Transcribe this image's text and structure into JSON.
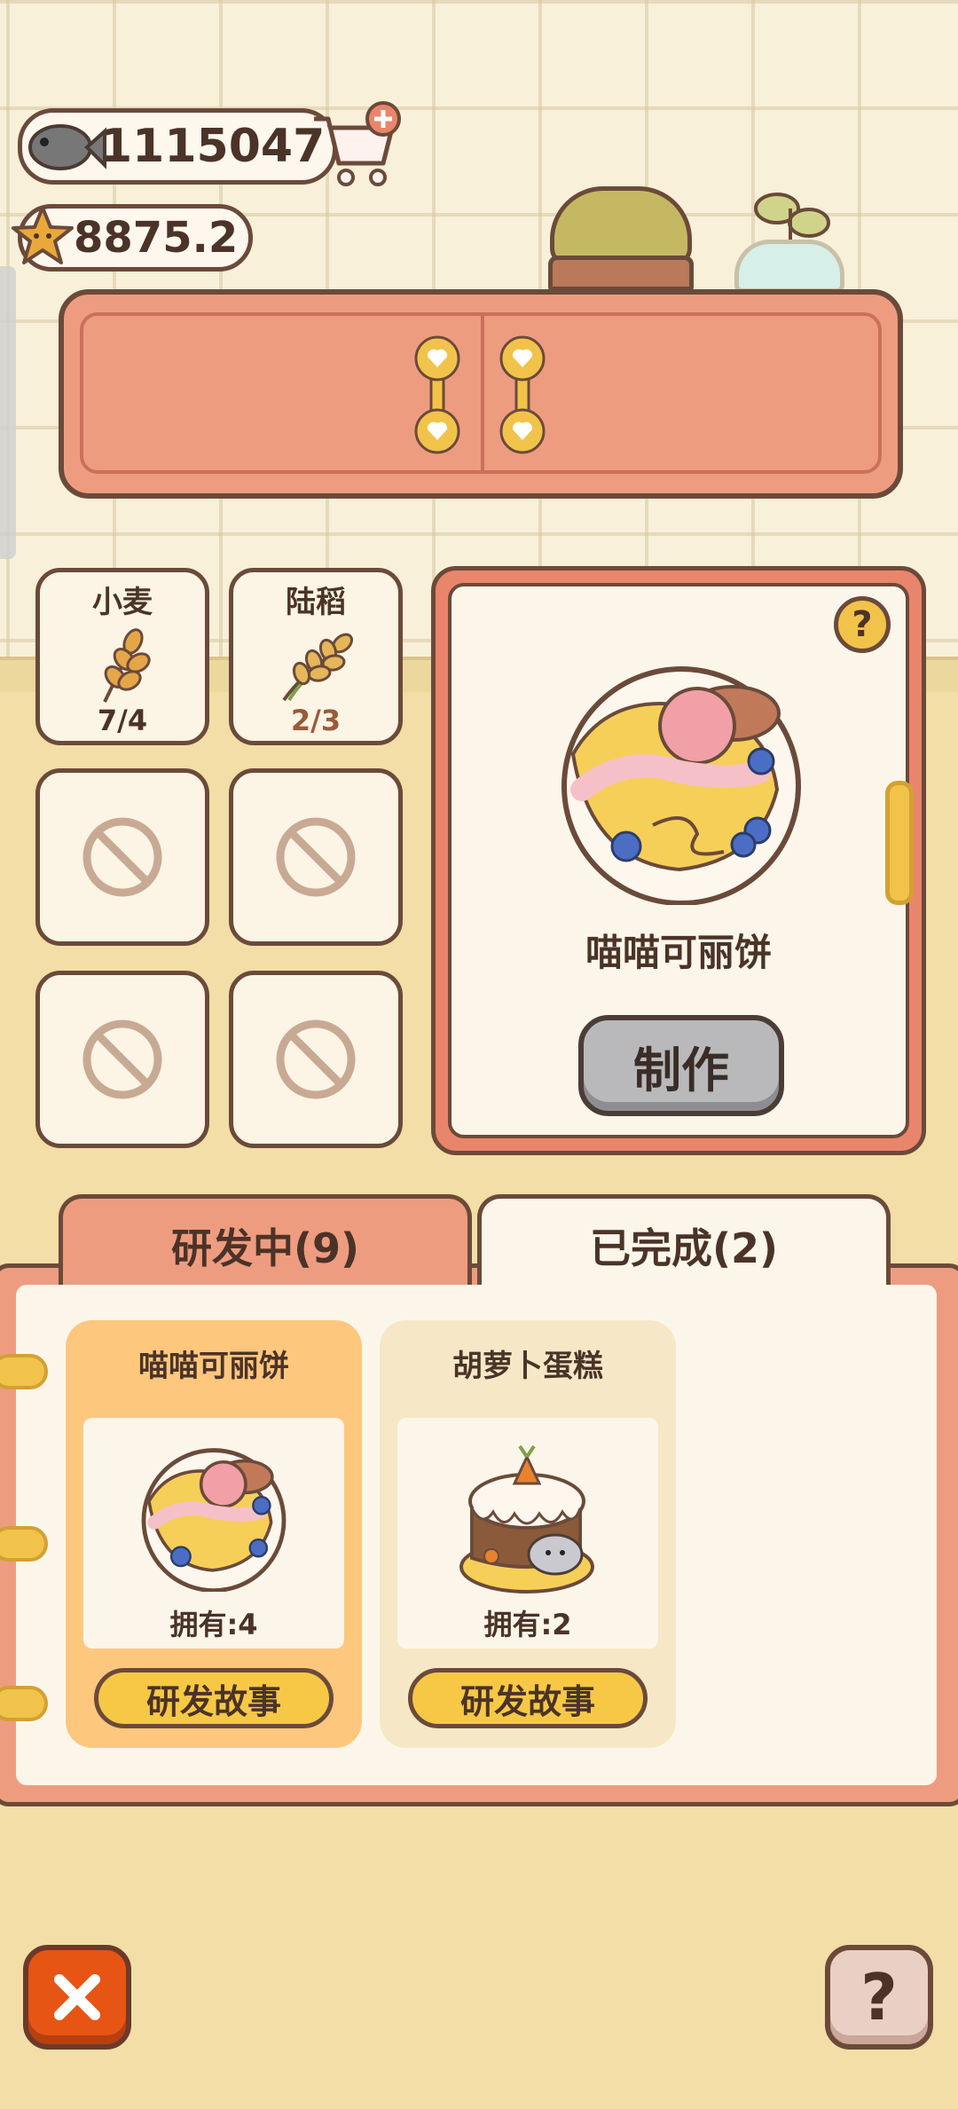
{
  "currency": {
    "fish": "1115047",
    "star": "8875.2"
  },
  "ingredients": [
    {
      "name": "小麦",
      "count": "7/4",
      "count_color": "#4b3328",
      "icon": "wheat-icon"
    },
    {
      "name": "陆稻",
      "count": "2/3",
      "count_color": "#9b5a3a",
      "icon": "rice-icon"
    }
  ],
  "locked_slot_icon": "ban-icon",
  "recipe": {
    "name": "喵喵可丽饼",
    "make_label": "制作",
    "help": "?"
  },
  "tabs": [
    {
      "label": "研发中(9)"
    },
    {
      "label": "已完成(2)"
    }
  ],
  "cards": [
    {
      "title": "喵喵可丽饼",
      "owned": "拥有:4",
      "button": "研发故事",
      "icon": "crepe-icon"
    },
    {
      "title": "胡萝卜蛋糕",
      "owned": "拥有:2",
      "button": "研发故事",
      "icon": "carrot-cake-icon"
    }
  ],
  "bottom": {
    "help": "?"
  },
  "colors": {
    "accent": "#ee9c80",
    "close": "#e65514",
    "gold": "#f2c34a"
  }
}
